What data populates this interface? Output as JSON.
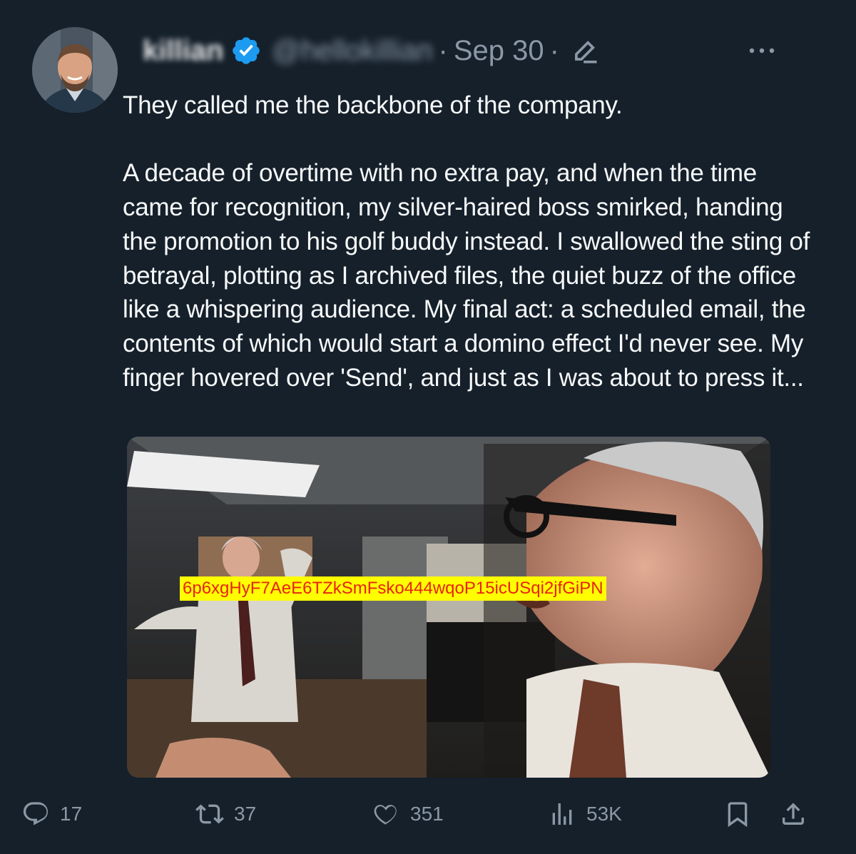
{
  "tweet": {
    "display_name": "killian",
    "handle": "@hellokillian",
    "separator": "·",
    "date": "Sep 30",
    "date_separator": "·",
    "text": "They called me the backbone of the company.\n\nA decade of overtime with no extra pay, and when the time came for recognition, my silver-haired boss smirked, handing the promotion to his golf buddy instead. I swallowed the sting of betrayal, plotting as I archived files, the quiet buzz of the office like a whispering audience. My final act: a scheduled email, the contents of which would start a domino effect I'd never see. My finger hovered over 'Send', and just as I was about to press it...",
    "media_watermark": "6p6xgHyF7AeE6TZkSmFsko444wqoP15icUSqi2jfGiPN"
  },
  "actions": {
    "replies": "17",
    "retweets": "37",
    "likes": "351",
    "views": "53K"
  },
  "icons": {
    "verified": "verified-badge-icon",
    "edit": "edit-pencil-icon",
    "more": "more-options-icon",
    "reply": "reply-icon",
    "retweet": "retweet-icon",
    "like": "like-heart-icon",
    "views": "views-chart-icon",
    "bookmark": "bookmark-icon",
    "share": "share-icon"
  },
  "colors": {
    "background": "#15202b",
    "text": "#f7f9f9",
    "muted": "#8b98a5",
    "verified": "#1d9bf0",
    "watermark_bg": "#ffff00",
    "watermark_text": "#e8230f"
  }
}
